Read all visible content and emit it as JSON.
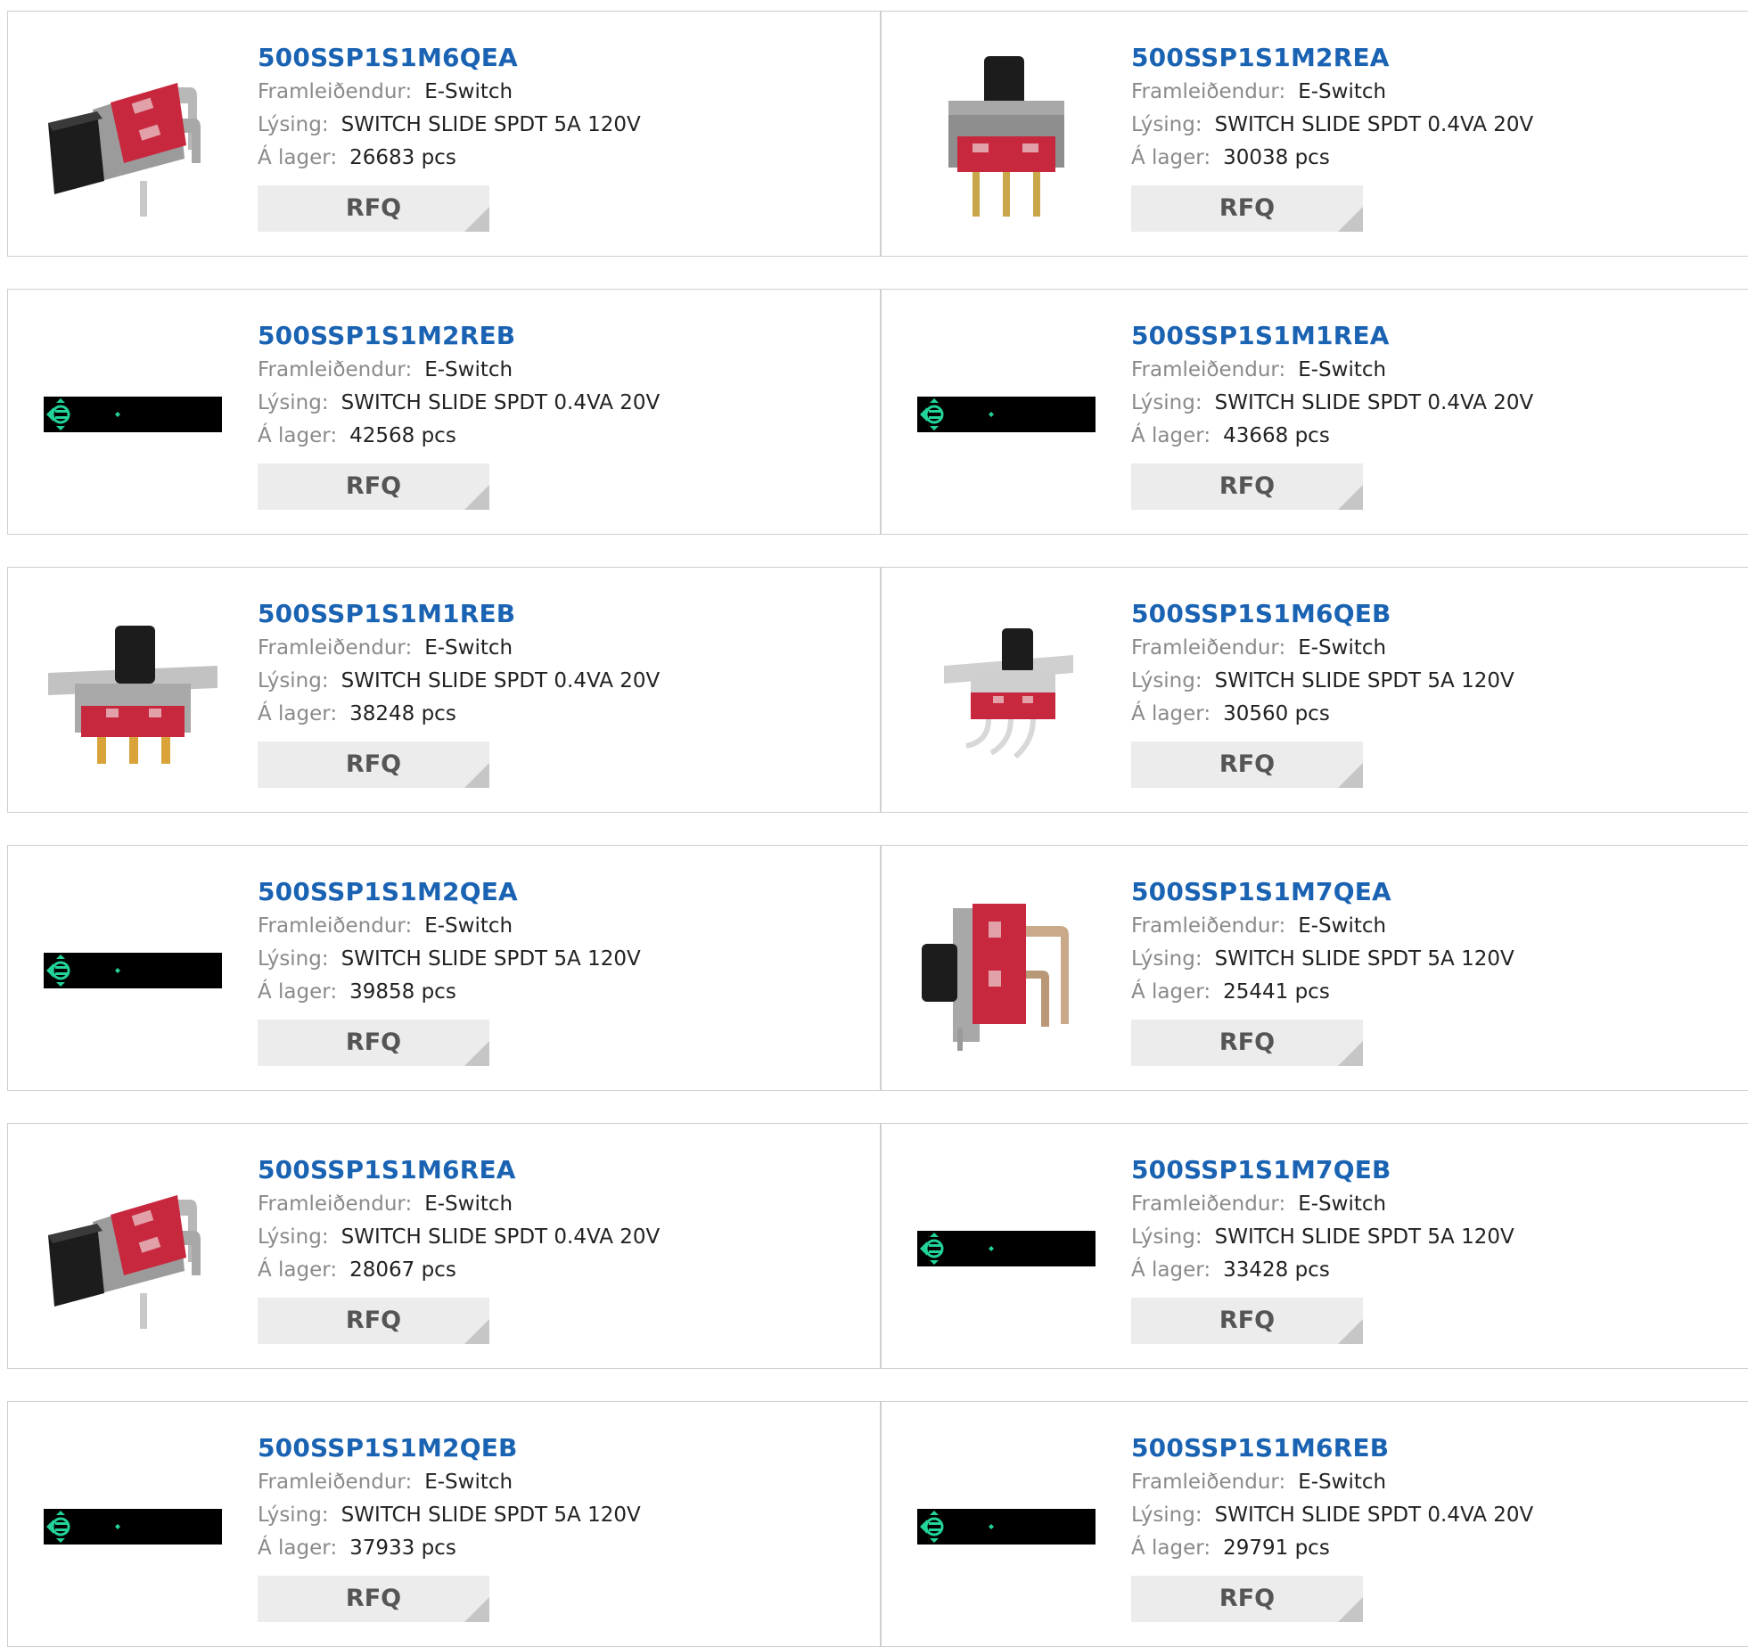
{
  "labels": {
    "manufacturer": "Framleiðendur:",
    "description": "Lýsing:",
    "stock": "Á lager:",
    "rfq": "RFQ"
  },
  "colors": {
    "link": "#1a63b3",
    "label": "#8a8a8a",
    "button_bg": "#ececec",
    "placeholder_bg": "#000000",
    "placeholder_icon": "#22d39a"
  },
  "products": [
    {
      "part": "500SSP1S1M6QEA",
      "manufacturer": "E-Switch",
      "description": "SWITCH SLIDE SPDT 5A 120V",
      "stock": "26683 pcs",
      "image": "slide-switch-right-angle-photo"
    },
    {
      "part": "500SSP1S1M2REA",
      "manufacturer": "E-Switch",
      "description": "SWITCH SLIDE SPDT 0.4VA 20V",
      "stock": "30038 pcs",
      "image": "slide-switch-vertical-photo"
    },
    {
      "part": "500SSP1S1M2REB",
      "manufacturer": "E-Switch",
      "description": "SWITCH SLIDE SPDT 0.4VA 20V",
      "stock": "42568 pcs",
      "image": "placeholder"
    },
    {
      "part": "500SSP1S1M1REA",
      "manufacturer": "E-Switch",
      "description": "SWITCH SLIDE SPDT 0.4VA 20V",
      "stock": "43668 pcs",
      "image": "placeholder"
    },
    {
      "part": "500SSP1S1M1REB",
      "manufacturer": "E-Switch",
      "description": "SWITCH SLIDE SPDT 0.4VA 20V",
      "stock": "38248 pcs",
      "image": "slide-switch-panel-mount-photo"
    },
    {
      "part": "500SSP1S1M6QEB",
      "manufacturer": "E-Switch",
      "description": "SWITCH SLIDE SPDT 5A 120V",
      "stock": "30560 pcs",
      "image": "slide-switch-bent-leads-photo"
    },
    {
      "part": "500SSP1S1M2QEA",
      "manufacturer": "E-Switch",
      "description": "SWITCH SLIDE SPDT 5A 120V",
      "stock": "39858 pcs",
      "image": "placeholder"
    },
    {
      "part": "500SSP1S1M7QEA",
      "manufacturer": "E-Switch",
      "description": "SWITCH SLIDE SPDT 5A 120V",
      "stock": "25441 pcs",
      "image": "slide-switch-side-view-photo"
    },
    {
      "part": "500SSP1S1M6REA",
      "manufacturer": "E-Switch",
      "description": "SWITCH SLIDE SPDT 0.4VA 20V",
      "stock": "28067 pcs",
      "image": "slide-switch-right-angle-photo"
    },
    {
      "part": "500SSP1S1M7QEB",
      "manufacturer": "E-Switch",
      "description": "SWITCH SLIDE SPDT 5A 120V",
      "stock": "33428 pcs",
      "image": "placeholder"
    },
    {
      "part": "500SSP1S1M2QEB",
      "manufacturer": "E-Switch",
      "description": "SWITCH SLIDE SPDT 5A 120V",
      "stock": "37933 pcs",
      "image": "placeholder"
    },
    {
      "part": "500SSP1S1M6REB",
      "manufacturer": "E-Switch",
      "description": "SWITCH SLIDE SPDT 0.4VA 20V",
      "stock": "29791 pcs",
      "image": "placeholder"
    }
  ]
}
